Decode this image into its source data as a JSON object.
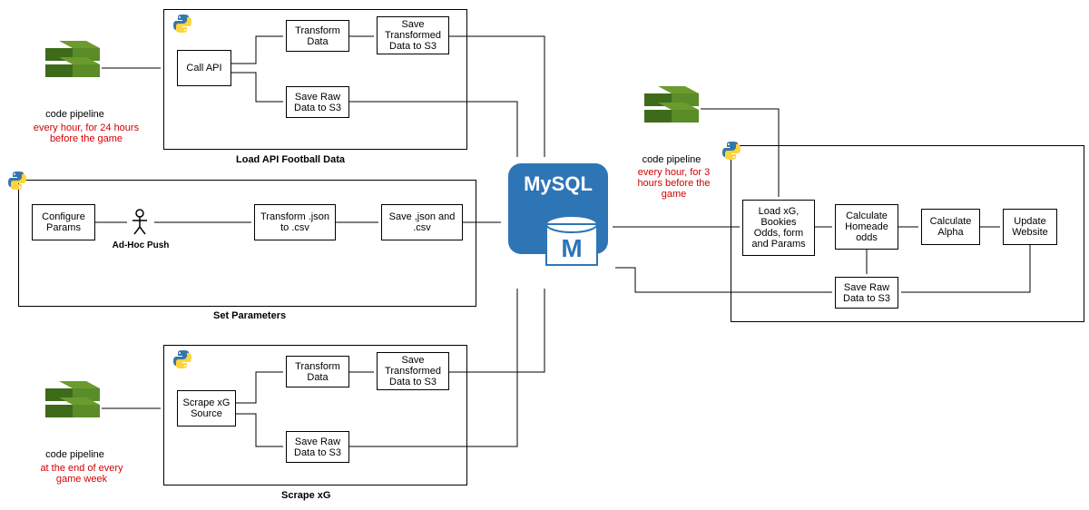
{
  "triggers": {
    "pipeline1": {
      "label": "code pipeline",
      "schedule": "every hour, for 24 hours before the game"
    },
    "pipeline2": {
      "label": "code pipeline",
      "schedule": "at the end of every game week"
    },
    "pipeline3": {
      "label": "code pipeline",
      "schedule": "every hour, for 3 hours before the game"
    },
    "adhoc": "Ad-Hoc Push"
  },
  "groups": {
    "load_api": {
      "title": "Load API Football Data",
      "call_api": "Call API",
      "transform": "Transform Data",
      "save_transformed": "Save Transformed Data to S3",
      "save_raw": "Save Raw Data to S3"
    },
    "set_params": {
      "title": "Set Parameters",
      "configure": "Configure Params",
      "transform": "Transform .json to .csv",
      "save": "Save ,json and .csv"
    },
    "scrape_xg": {
      "title": "Scrape xG",
      "scrape": "Scrape xG Source",
      "transform": "Transform Data",
      "save_transformed": "Save Transformed Data to S3",
      "save_raw": "Save Raw Data to S3"
    },
    "odds": {
      "load": "Load xG, Bookies Odds, form and Params",
      "homeade": "Calculate Homeade odds",
      "alpha": "Calculate Alpha",
      "update": "Update Website",
      "save_raw": "Save Raw Data to S3"
    }
  },
  "db": {
    "name": "MySQL"
  },
  "icons": {
    "python": "python-icon",
    "aws": "aws-stack-icon",
    "stick": "stick-figure-icon"
  }
}
